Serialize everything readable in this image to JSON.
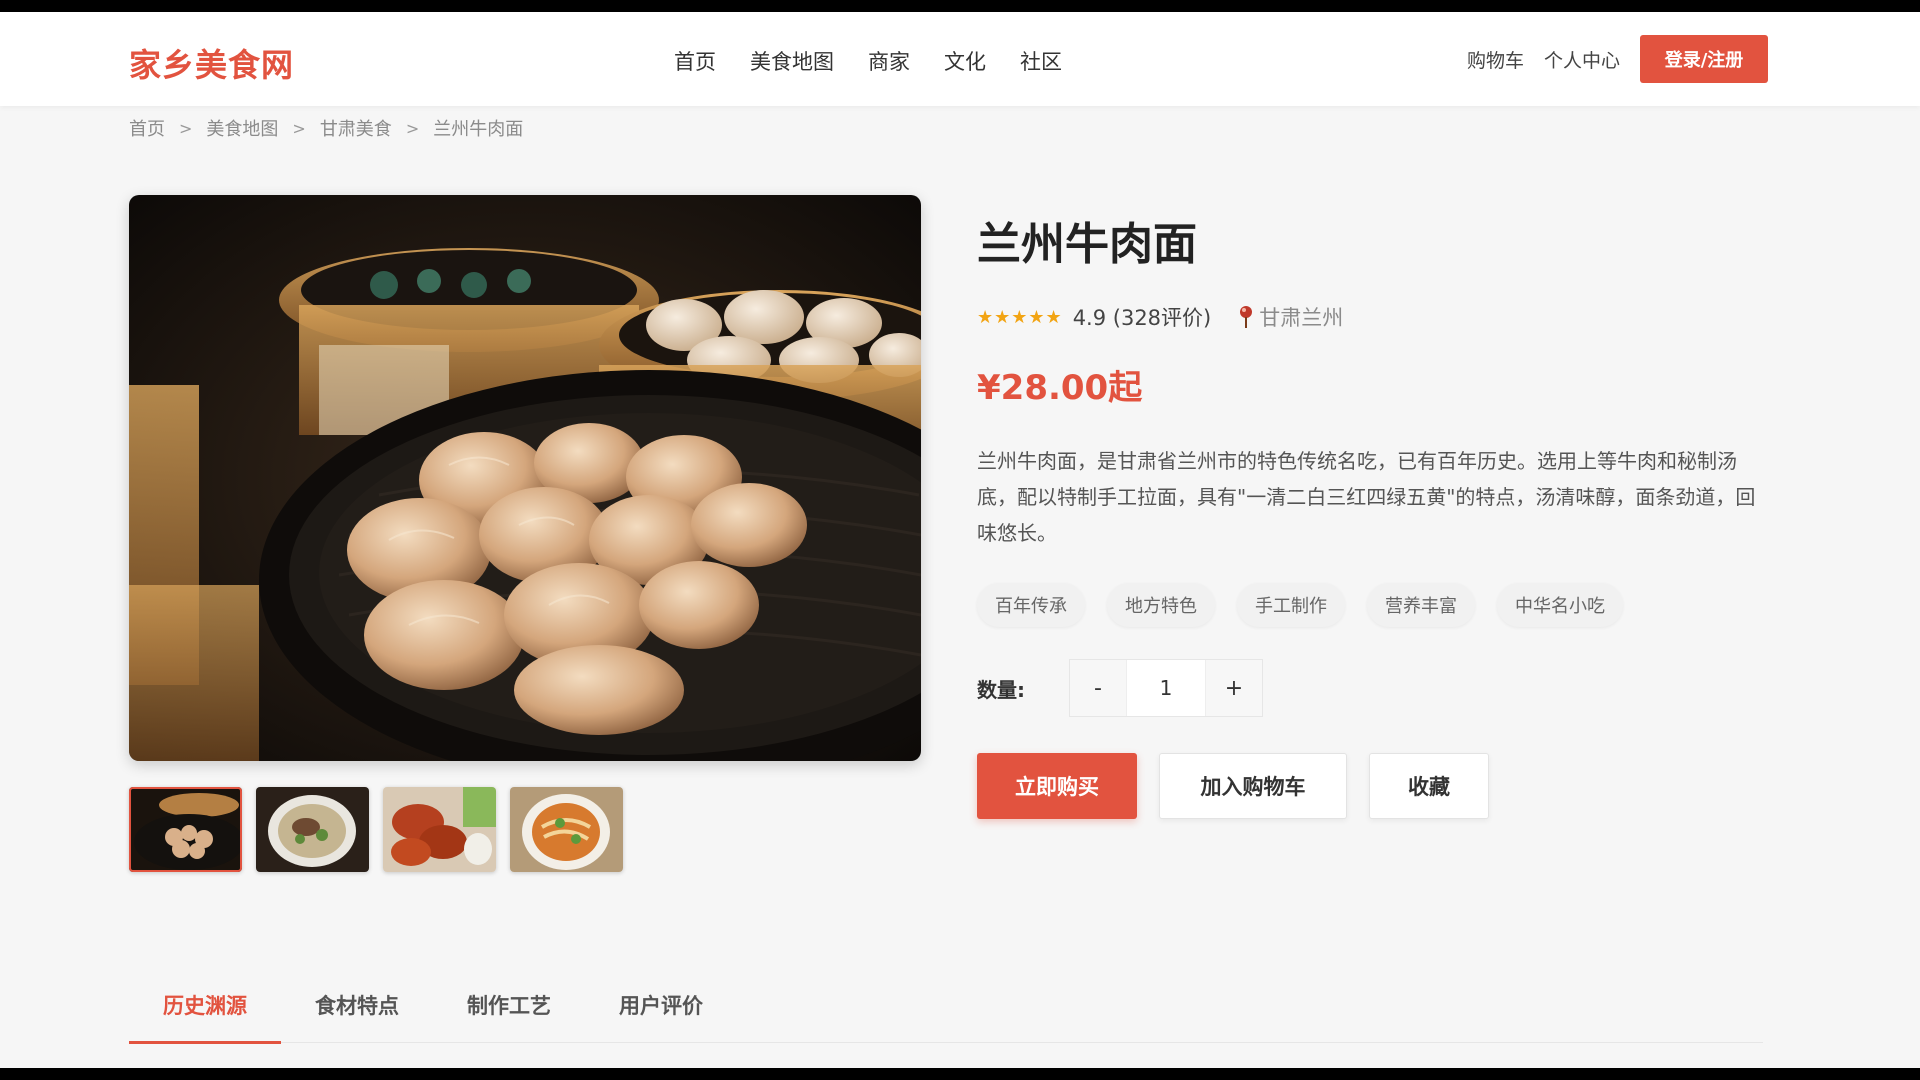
{
  "site": {
    "logo": "家乡美食网",
    "brand_color": "#e2533f"
  },
  "nav": {
    "items": [
      "首页",
      "美食地图",
      "商家",
      "文化",
      "社区"
    ]
  },
  "header_right": {
    "cart": "购物车",
    "profile": "个人中心",
    "login": "登录/注册"
  },
  "breadcrumb": {
    "items": [
      "首页",
      "美食地图",
      "甘肃美食",
      "兰州牛肉面"
    ],
    "separator": ">"
  },
  "gallery": {
    "thumbnails": [
      "dumplings-steamer",
      "beef-noodle-soup",
      "spicy-chicken-wings",
      "beef-noodles-garnish"
    ],
    "active_index": 0
  },
  "product": {
    "title": "兰州牛肉面",
    "stars": "★★★★★",
    "rating_text": "4.9 (328评价)",
    "location": "甘肃兰州",
    "price": "¥28.00起",
    "description": "兰州牛肉面，是甘肃省兰州市的特色传统名吃，已有百年历史。选用上等牛肉和秘制汤底，配以特制手工拉面，具有\"一清二白三红四绿五黄\"的特点，汤清味醇，面条劲道，回味悠长。",
    "tags": [
      "百年传承",
      "地方特色",
      "手工制作",
      "营养丰富",
      "中华名小吃"
    ],
    "quantity_label": "数量:",
    "quantity": "1",
    "decrement": "-",
    "increment": "+"
  },
  "actions": {
    "buy_now": "立即购买",
    "add_to_cart": "加入购物车",
    "favorite": "收藏"
  },
  "tabs": {
    "items": [
      "历史渊源",
      "食材特点",
      "制作工艺",
      "用户评价"
    ],
    "active_index": 0
  }
}
